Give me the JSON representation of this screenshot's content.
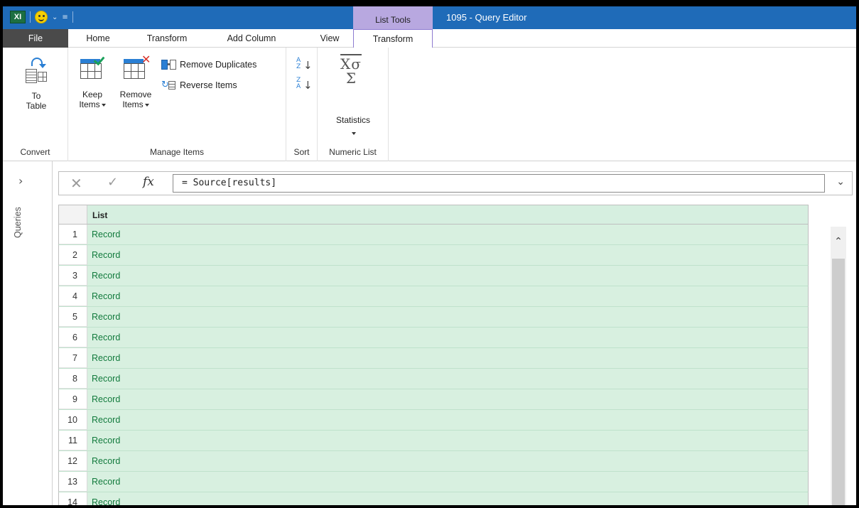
{
  "titlebar": {
    "app_logo": "XI",
    "contextual_group": "List Tools",
    "window_title": "1095 - Query Editor"
  },
  "tabs": [
    {
      "label": "File"
    },
    {
      "label": "Home"
    },
    {
      "label": "Transform"
    },
    {
      "label": "Add Column"
    },
    {
      "label": "View"
    },
    {
      "label": "Transform"
    }
  ],
  "ribbon": {
    "convert": {
      "group_label": "Convert",
      "to_table_line1": "To",
      "to_table_line2": "Table"
    },
    "manage_items": {
      "group_label": "Manage Items",
      "keep_line1": "Keep",
      "keep_line2": "Items",
      "remove_line1": "Remove",
      "remove_line2": "Items",
      "remove_duplicates": "Remove Duplicates",
      "reverse_items": "Reverse Items"
    },
    "sort": {
      "group_label": "Sort"
    },
    "numeric_list": {
      "group_label": "Numeric List",
      "statistics": "Statistics"
    }
  },
  "sidebar": {
    "label": "Queries"
  },
  "formula_bar": {
    "fx": "fx",
    "formula": "= Source[results]"
  },
  "grid": {
    "column_header": "List",
    "rows": [
      {
        "num": "1",
        "value": "Record"
      },
      {
        "num": "2",
        "value": "Record"
      },
      {
        "num": "3",
        "value": "Record"
      },
      {
        "num": "4",
        "value": "Record"
      },
      {
        "num": "5",
        "value": "Record"
      },
      {
        "num": "6",
        "value": "Record"
      },
      {
        "num": "7",
        "value": "Record"
      },
      {
        "num": "8",
        "value": "Record"
      },
      {
        "num": "9",
        "value": "Record"
      },
      {
        "num": "10",
        "value": "Record"
      },
      {
        "num": "11",
        "value": "Record"
      },
      {
        "num": "12",
        "value": "Record"
      },
      {
        "num": "13",
        "value": "Record"
      },
      {
        "num": "14",
        "value": "Record"
      }
    ]
  },
  "colors": {
    "titlebar": "#1f6bb8",
    "contextual_tab": "#b8a8e0",
    "file_tab": "#4a4a4a",
    "cell_fill": "#d8f0e0",
    "cell_text": "#117a3c"
  }
}
